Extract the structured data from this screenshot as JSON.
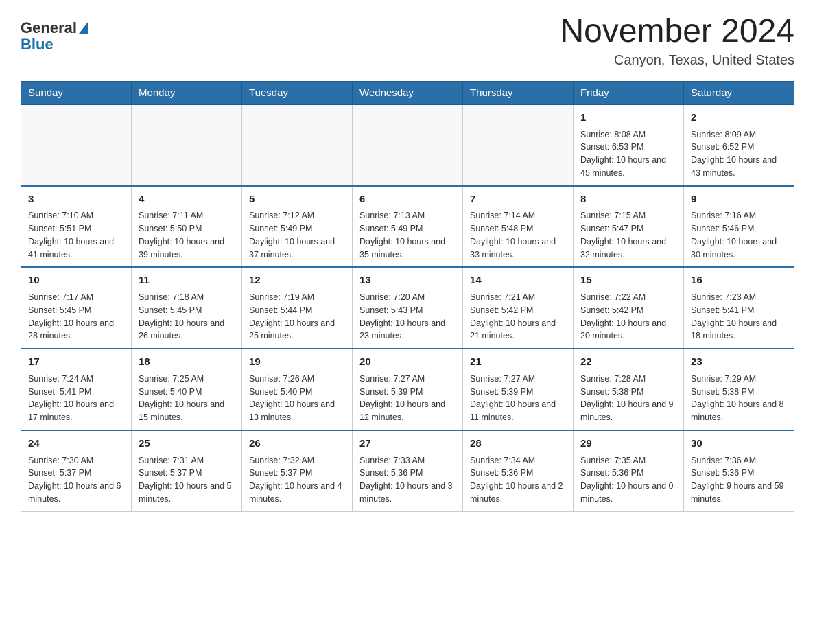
{
  "header": {
    "logo": {
      "general": "General",
      "blue": "Blue"
    },
    "month": "November 2024",
    "location": "Canyon, Texas, United States"
  },
  "weekdays": [
    "Sunday",
    "Monday",
    "Tuesday",
    "Wednesday",
    "Thursday",
    "Friday",
    "Saturday"
  ],
  "weeks": [
    [
      {
        "day": "",
        "info": ""
      },
      {
        "day": "",
        "info": ""
      },
      {
        "day": "",
        "info": ""
      },
      {
        "day": "",
        "info": ""
      },
      {
        "day": "",
        "info": ""
      },
      {
        "day": "1",
        "info": "Sunrise: 8:08 AM\nSunset: 6:53 PM\nDaylight: 10 hours and 45 minutes."
      },
      {
        "day": "2",
        "info": "Sunrise: 8:09 AM\nSunset: 6:52 PM\nDaylight: 10 hours and 43 minutes."
      }
    ],
    [
      {
        "day": "3",
        "info": "Sunrise: 7:10 AM\nSunset: 5:51 PM\nDaylight: 10 hours and 41 minutes."
      },
      {
        "day": "4",
        "info": "Sunrise: 7:11 AM\nSunset: 5:50 PM\nDaylight: 10 hours and 39 minutes."
      },
      {
        "day": "5",
        "info": "Sunrise: 7:12 AM\nSunset: 5:49 PM\nDaylight: 10 hours and 37 minutes."
      },
      {
        "day": "6",
        "info": "Sunrise: 7:13 AM\nSunset: 5:49 PM\nDaylight: 10 hours and 35 minutes."
      },
      {
        "day": "7",
        "info": "Sunrise: 7:14 AM\nSunset: 5:48 PM\nDaylight: 10 hours and 33 minutes."
      },
      {
        "day": "8",
        "info": "Sunrise: 7:15 AM\nSunset: 5:47 PM\nDaylight: 10 hours and 32 minutes."
      },
      {
        "day": "9",
        "info": "Sunrise: 7:16 AM\nSunset: 5:46 PM\nDaylight: 10 hours and 30 minutes."
      }
    ],
    [
      {
        "day": "10",
        "info": "Sunrise: 7:17 AM\nSunset: 5:45 PM\nDaylight: 10 hours and 28 minutes."
      },
      {
        "day": "11",
        "info": "Sunrise: 7:18 AM\nSunset: 5:45 PM\nDaylight: 10 hours and 26 minutes."
      },
      {
        "day": "12",
        "info": "Sunrise: 7:19 AM\nSunset: 5:44 PM\nDaylight: 10 hours and 25 minutes."
      },
      {
        "day": "13",
        "info": "Sunrise: 7:20 AM\nSunset: 5:43 PM\nDaylight: 10 hours and 23 minutes."
      },
      {
        "day": "14",
        "info": "Sunrise: 7:21 AM\nSunset: 5:42 PM\nDaylight: 10 hours and 21 minutes."
      },
      {
        "day": "15",
        "info": "Sunrise: 7:22 AM\nSunset: 5:42 PM\nDaylight: 10 hours and 20 minutes."
      },
      {
        "day": "16",
        "info": "Sunrise: 7:23 AM\nSunset: 5:41 PM\nDaylight: 10 hours and 18 minutes."
      }
    ],
    [
      {
        "day": "17",
        "info": "Sunrise: 7:24 AM\nSunset: 5:41 PM\nDaylight: 10 hours and 17 minutes."
      },
      {
        "day": "18",
        "info": "Sunrise: 7:25 AM\nSunset: 5:40 PM\nDaylight: 10 hours and 15 minutes."
      },
      {
        "day": "19",
        "info": "Sunrise: 7:26 AM\nSunset: 5:40 PM\nDaylight: 10 hours and 13 minutes."
      },
      {
        "day": "20",
        "info": "Sunrise: 7:27 AM\nSunset: 5:39 PM\nDaylight: 10 hours and 12 minutes."
      },
      {
        "day": "21",
        "info": "Sunrise: 7:27 AM\nSunset: 5:39 PM\nDaylight: 10 hours and 11 minutes."
      },
      {
        "day": "22",
        "info": "Sunrise: 7:28 AM\nSunset: 5:38 PM\nDaylight: 10 hours and 9 minutes."
      },
      {
        "day": "23",
        "info": "Sunrise: 7:29 AM\nSunset: 5:38 PM\nDaylight: 10 hours and 8 minutes."
      }
    ],
    [
      {
        "day": "24",
        "info": "Sunrise: 7:30 AM\nSunset: 5:37 PM\nDaylight: 10 hours and 6 minutes."
      },
      {
        "day": "25",
        "info": "Sunrise: 7:31 AM\nSunset: 5:37 PM\nDaylight: 10 hours and 5 minutes."
      },
      {
        "day": "26",
        "info": "Sunrise: 7:32 AM\nSunset: 5:37 PM\nDaylight: 10 hours and 4 minutes."
      },
      {
        "day": "27",
        "info": "Sunrise: 7:33 AM\nSunset: 5:36 PM\nDaylight: 10 hours and 3 minutes."
      },
      {
        "day": "28",
        "info": "Sunrise: 7:34 AM\nSunset: 5:36 PM\nDaylight: 10 hours and 2 minutes."
      },
      {
        "day": "29",
        "info": "Sunrise: 7:35 AM\nSunset: 5:36 PM\nDaylight: 10 hours and 0 minutes."
      },
      {
        "day": "30",
        "info": "Sunrise: 7:36 AM\nSunset: 5:36 PM\nDaylight: 9 hours and 59 minutes."
      }
    ]
  ]
}
